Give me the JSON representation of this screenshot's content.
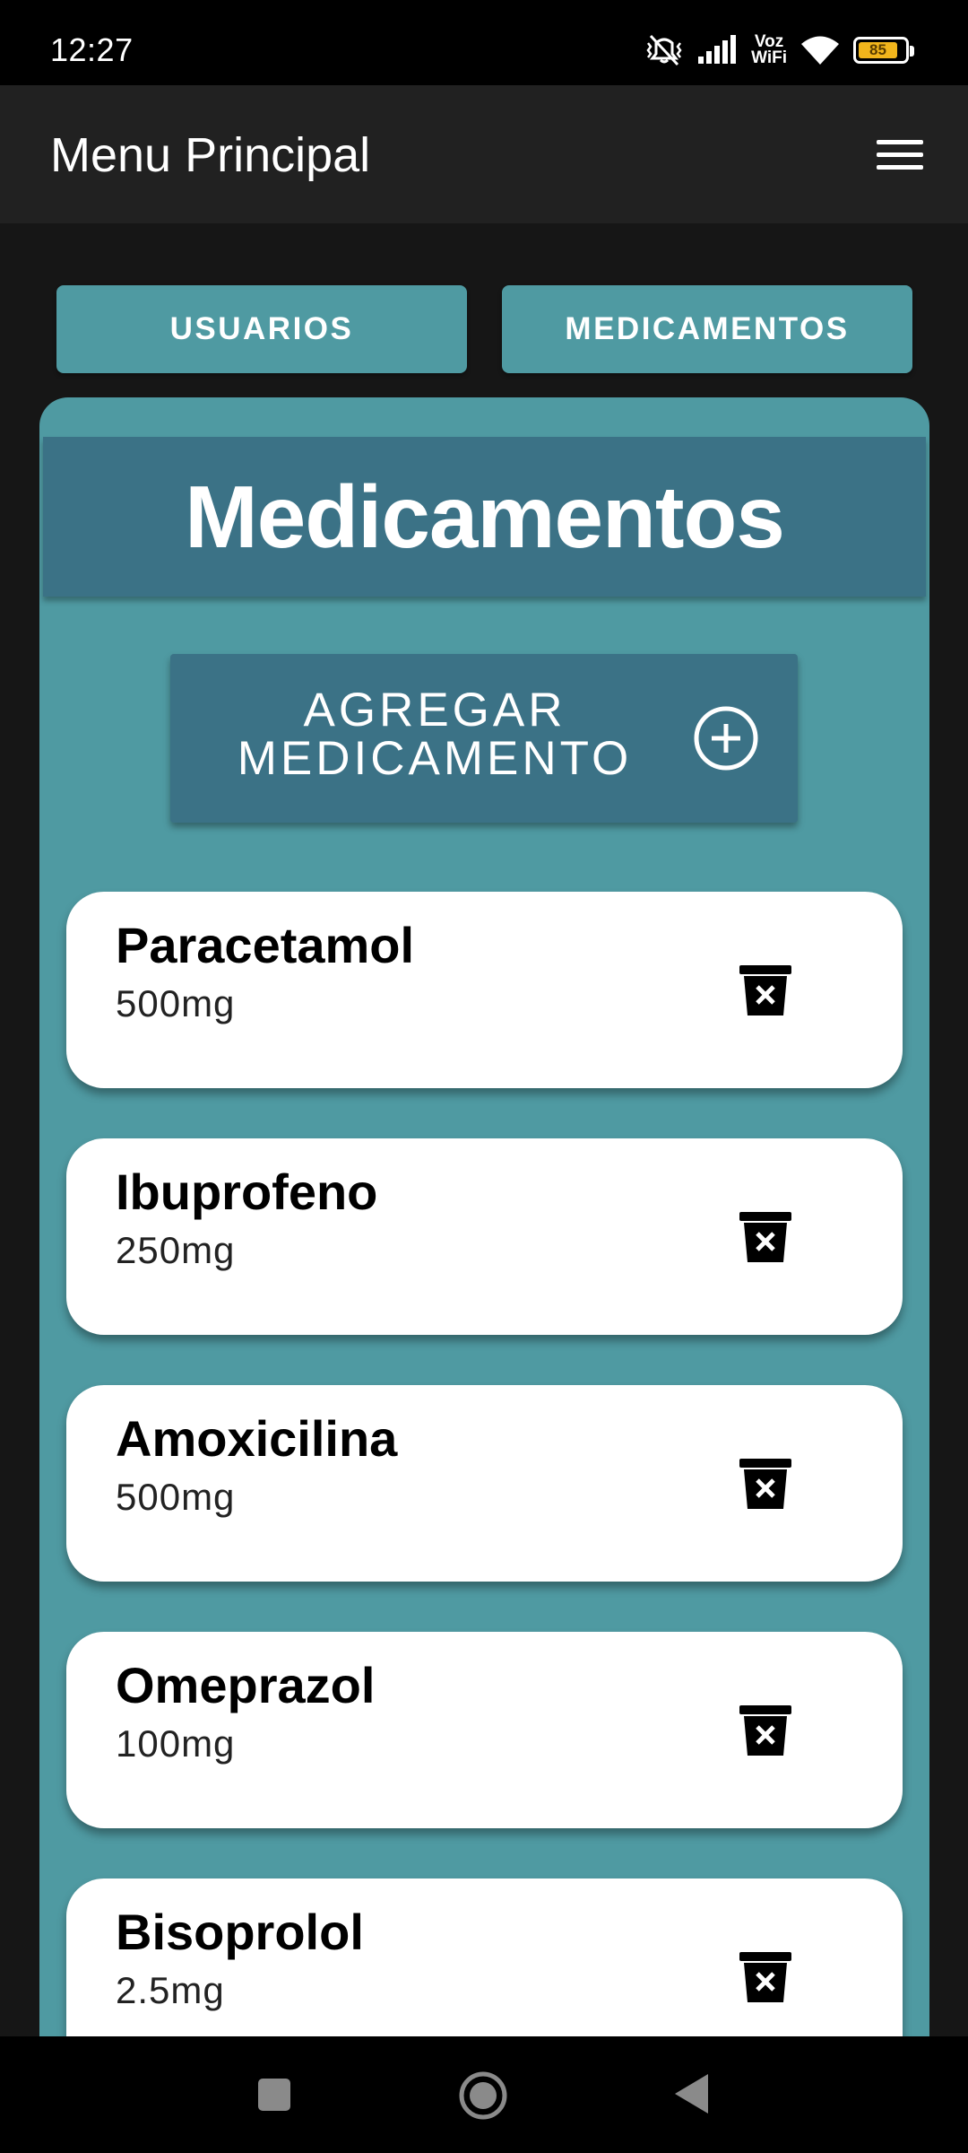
{
  "status_bar": {
    "time": "12:27",
    "network_label_top": "Voz",
    "network_label_bottom": "WiFi",
    "battery_level": "85"
  },
  "app_bar": {
    "title": "Menu Principal",
    "menu_icon": "hamburger-menu-icon"
  },
  "tabs": [
    {
      "label": "USUARIOS"
    },
    {
      "label": "MEDICAMENTOS"
    }
  ],
  "panel": {
    "title": "Medicamentos",
    "add_button": {
      "line1": "AGREGAR",
      "line2": "MEDICAMENTO",
      "icon": "plus-circle-icon"
    }
  },
  "medications": [
    {
      "name": "Paracetamol",
      "dose": "500mg"
    },
    {
      "name": "Ibuprofeno",
      "dose": "250mg"
    },
    {
      "name": "Amoxicilina",
      "dose": "500mg"
    },
    {
      "name": "Omeprazol",
      "dose": "100mg"
    },
    {
      "name": "Bisoprolol",
      "dose": "2.5mg"
    }
  ],
  "colors": {
    "accent": "#4f9aa2",
    "header": "#3b7286",
    "app_bar": "#212121",
    "background": "#161616"
  }
}
